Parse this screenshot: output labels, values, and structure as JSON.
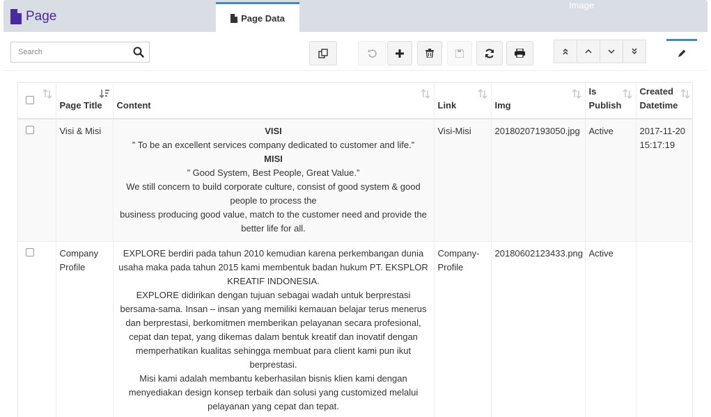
{
  "header": {
    "title": "Page",
    "tab_data": "Page Data",
    "tab_image": "Image",
    "accent_color": "#4a2aa0",
    "tab_border_color": "#3c8dbc"
  },
  "toolbar": {
    "search_placeholder": "Search",
    "search_value": "",
    "buttons": [
      "copy-icon",
      "undo-icon",
      "plus-icon",
      "trash-icon",
      "save-icon",
      "refresh-icon",
      "print-icon"
    ],
    "nav_buttons": [
      "double-chevron-up-icon",
      "chevron-up-icon",
      "chevron-down-icon",
      "double-chevron-down-icon"
    ],
    "edit_icon": "pencil-icon"
  },
  "table": {
    "columns": [
      "Page Title",
      "Content",
      "Link",
      "Img",
      "Is Publish",
      "Created Datetime"
    ],
    "rows": [
      {
        "title": "Visi & Misi",
        "content": {
          "h1": "VISI",
          "p1": "” To be an excellent services company dedicated to customer and life.”",
          "h2": "MISI",
          "p2": "” Good System, Best People, Great Value.”",
          "p3": "We still concern to build corporate culture, consist of good system & good people to process the",
          "p4": "business producing good value, match to the customer need and provide the better life for all."
        },
        "link": "Visi-Misi",
        "img": "20180207193050.jpg",
        "publish": "Active",
        "created": "2017-11-20 15:17:19"
      },
      {
        "title": "Company Profile",
        "content": {
          "p1": "EXPLORE berdiri pada tahun 2010 kemudian karena perkembangan dunia usaha maka pada tahun 2015 kami membentuk badan hukum PT. EKSPLOR KREATIF INDONESIA.",
          "p2": "EXPLORE didirikan dengan tujuan sebagai wadah untuk berprestasi bersama-sama. Insan – insan yang memiliki kemauan belajar terus menerus dan berprestasi, berkomitmen memberikan pelayanan secara profesional, cepat dan tepat, yang dikemas dalam bentuk kreatif dan inovatif dengan memperhatikan kualitas sehingga membuat para client kami pun ikut berprestasi.",
          "p3": "Misi kami adalah membantu keberhasilan bisnis klien kami dengan menyediakan design konsep terbaik dan solusi yang customized melalui pelayanan yang cepat dan tepat."
        },
        "link": "Company-Profile",
        "img": "20180602123433.png",
        "publish": "Active",
        "created": ""
      }
    ]
  }
}
